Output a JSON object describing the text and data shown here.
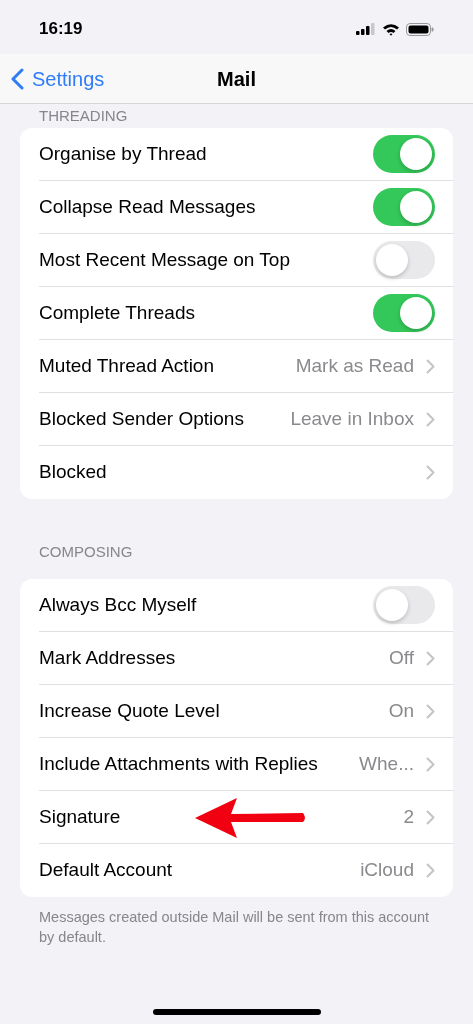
{
  "status_bar": {
    "time": "16:19"
  },
  "nav": {
    "back": "Settings",
    "title": "Mail"
  },
  "sections": [
    {
      "header": "THREADING",
      "rows": [
        {
          "kind": "toggle",
          "label": "Organise by Thread",
          "on": true
        },
        {
          "kind": "toggle",
          "label": "Collapse Read Messages",
          "on": true
        },
        {
          "kind": "toggle",
          "label": "Most Recent Message on Top",
          "on": false
        },
        {
          "kind": "toggle",
          "label": "Complete Threads",
          "on": true
        },
        {
          "kind": "link",
          "label": "Muted Thread Action",
          "value": "Mark as Read"
        },
        {
          "kind": "link",
          "label": "Blocked Sender Options",
          "value": "Leave in Inbox"
        },
        {
          "kind": "link",
          "label": "Blocked"
        }
      ]
    },
    {
      "header": "COMPOSING",
      "footer": "Messages created outside Mail will be sent from this account by default.",
      "rows": [
        {
          "kind": "toggle",
          "label": "Always Bcc Myself",
          "on": false
        },
        {
          "kind": "link",
          "label": "Mark Addresses",
          "value": "Off"
        },
        {
          "kind": "link",
          "label": "Increase Quote Level",
          "value": "On"
        },
        {
          "kind": "link",
          "label": "Include Attachments with Replies",
          "value": "Whe..."
        },
        {
          "kind": "link",
          "label": "Signature",
          "value": "2",
          "annotated": true
        },
        {
          "kind": "link",
          "label": "Default Account",
          "value": "iCloud"
        }
      ]
    }
  ]
}
